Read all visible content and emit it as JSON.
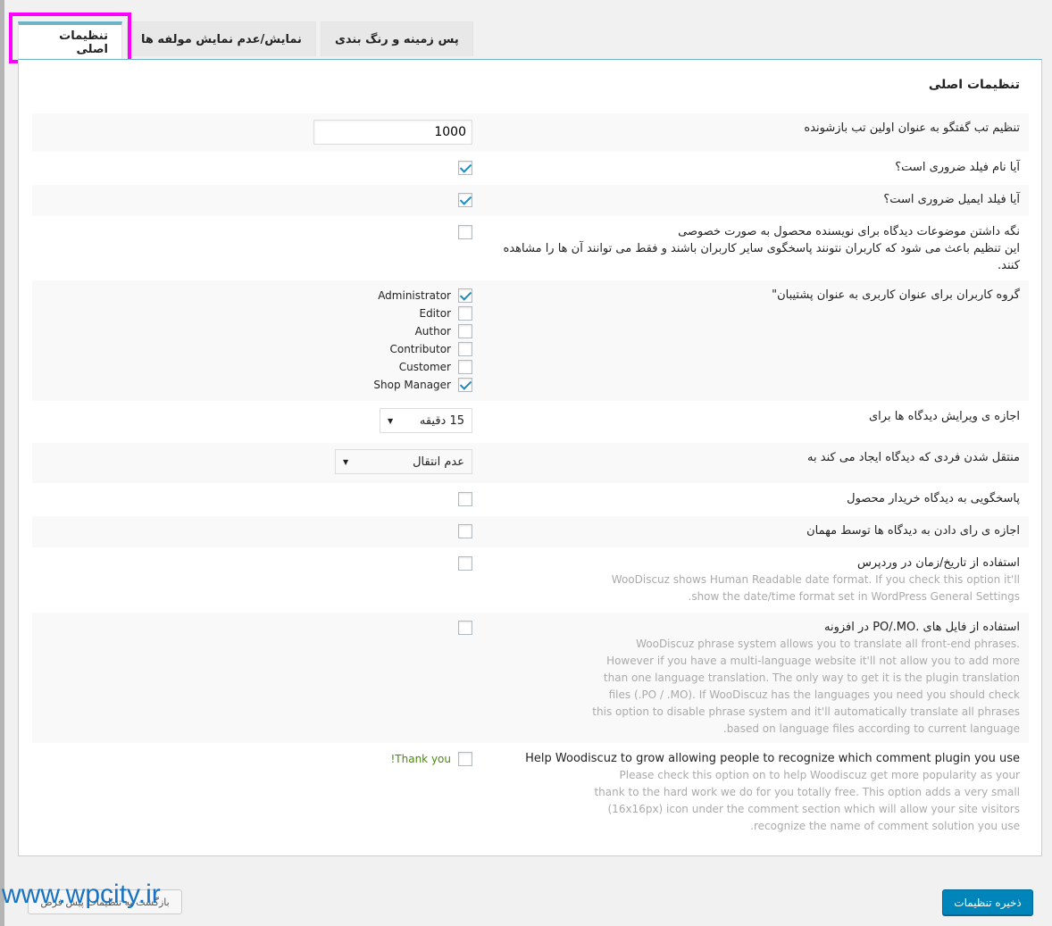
{
  "tabs": [
    {
      "label": "تنظیمات اصلی",
      "active": true
    },
    {
      "label": "نمایش/عدم نمایش مولفه ها"
    },
    {
      "label": "پس زمینه و رنگ بندی"
    }
  ],
  "panel_title": "تنظیمات اصلی",
  "rows": [
    {
      "type": "text",
      "label": "تنظیم تب گفتگو به عنوان اولین تب بازشونده",
      "value": "1000",
      "h": 44
    },
    {
      "type": "checkbox",
      "label": "آیا نام فیلد ضروری است؟",
      "checked": true,
      "h": 36
    },
    {
      "type": "checkbox",
      "label": "آیا فیلد ایمیل ضروری است؟",
      "checked": true,
      "h": 36
    },
    {
      "type": "checkbox",
      "label": "نگه داشتن موضوعات دیدگاه برای نویسنده محصول به صورت خصوصی",
      "label2": "این تنظیم باعث می شود که کاربران نتونند پاسخگوی سایر کاربران باشند و فقط می توانند آن ها را مشاهده کنند.",
      "checked": false,
      "h": 71
    },
    {
      "type": "roles",
      "label": "گروه کاربران برای عنوان کاربری به عنوان پشتیبان\"",
      "roles": [
        {
          "name": "Administrator",
          "checked": true
        },
        {
          "name": "Editor",
          "checked": false
        },
        {
          "name": "Author",
          "checked": false
        },
        {
          "name": "Contributor",
          "checked": false
        },
        {
          "name": "Customer",
          "checked": false
        },
        {
          "name": "Shop Manager",
          "checked": true
        }
      ],
      "h": 136
    },
    {
      "type": "select",
      "label": "اجازه ی ویرایش دیدگاه ها برای",
      "value": "15 دقیقه",
      "width": 104,
      "h": 46
    },
    {
      "type": "select",
      "label": "منتقل شدن فردی که دیدگاه ایجاد می کند به",
      "value": "عدم انتقال",
      "width": 154,
      "h": 46
    },
    {
      "type": "checkbox",
      "label": "پاسخگویی به دیدگاه خریدار محصول",
      "checked": false,
      "h": 36
    },
    {
      "type": "checkbox",
      "label": "اجازه ی رای دادن به دیدگاه ها توسط مهمان",
      "checked": false,
      "h": 36
    },
    {
      "type": "checkbox",
      "label": "استفاده از تاریخ/زمان در وردپرس",
      "desc": "WooDiscuz shows Human Readable date format. If you check this option it'll show the date/time format set in WordPress General Settings.",
      "checked": false,
      "h": 72
    },
    {
      "type": "checkbox",
      "label": "استفاده از فایل های .PO/.MO در افزونه",
      "desc": "WooDiscuz phrase system allows you to translate all front-end phrases. However if you have a multi-language website it'll not allow you to add more than one language translation. The only way to get it is the plugin translation files (.PO / .MO). If WooDiscuz has the languages you need you should check this option to disable phrase system and it'll automatically translate all phrases based on language files according to current language.",
      "checked": false,
      "h": 147
    },
    {
      "type": "checkbox",
      "label": "Help Woodiscuz to grow allowing people to recognize which comment plugin you use",
      "desc": "Please check this option on to help Woodiscuz get more popularity as your thank to the hard work we do for you totally free. This option adds a very small (16x16px) icon under the comment section which will allow your site visitors recognize the name of comment solution you use.",
      "checked": false,
      "extra": "Thank you!",
      "h": 111
    }
  ],
  "buttons": {
    "save": "ذخیره تنظیمات",
    "reset": "بازگشت به تنظیمات پیش فرض"
  },
  "watermark": "www.wpcity.ir",
  "colors": {
    "accent": "#0085ba",
    "tab_border": "#6fb3c6",
    "highlight": "#ff00ff",
    "check": "#1e8cbe"
  }
}
